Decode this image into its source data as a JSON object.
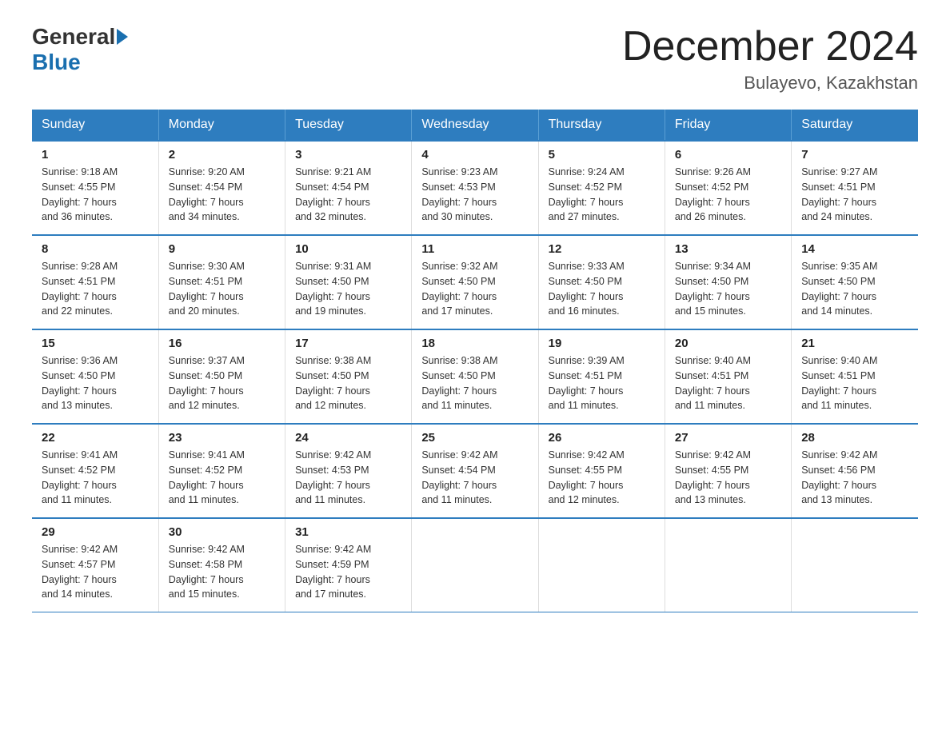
{
  "logo": {
    "general": "General",
    "blue": "Blue"
  },
  "title": "December 2024",
  "subtitle": "Bulayevo, Kazakhstan",
  "headers": [
    "Sunday",
    "Monday",
    "Tuesday",
    "Wednesday",
    "Thursday",
    "Friday",
    "Saturday"
  ],
  "weeks": [
    [
      {
        "day": "1",
        "info": "Sunrise: 9:18 AM\nSunset: 4:55 PM\nDaylight: 7 hours\nand 36 minutes."
      },
      {
        "day": "2",
        "info": "Sunrise: 9:20 AM\nSunset: 4:54 PM\nDaylight: 7 hours\nand 34 minutes."
      },
      {
        "day": "3",
        "info": "Sunrise: 9:21 AM\nSunset: 4:54 PM\nDaylight: 7 hours\nand 32 minutes."
      },
      {
        "day": "4",
        "info": "Sunrise: 9:23 AM\nSunset: 4:53 PM\nDaylight: 7 hours\nand 30 minutes."
      },
      {
        "day": "5",
        "info": "Sunrise: 9:24 AM\nSunset: 4:52 PM\nDaylight: 7 hours\nand 27 minutes."
      },
      {
        "day": "6",
        "info": "Sunrise: 9:26 AM\nSunset: 4:52 PM\nDaylight: 7 hours\nand 26 minutes."
      },
      {
        "day": "7",
        "info": "Sunrise: 9:27 AM\nSunset: 4:51 PM\nDaylight: 7 hours\nand 24 minutes."
      }
    ],
    [
      {
        "day": "8",
        "info": "Sunrise: 9:28 AM\nSunset: 4:51 PM\nDaylight: 7 hours\nand 22 minutes."
      },
      {
        "day": "9",
        "info": "Sunrise: 9:30 AM\nSunset: 4:51 PM\nDaylight: 7 hours\nand 20 minutes."
      },
      {
        "day": "10",
        "info": "Sunrise: 9:31 AM\nSunset: 4:50 PM\nDaylight: 7 hours\nand 19 minutes."
      },
      {
        "day": "11",
        "info": "Sunrise: 9:32 AM\nSunset: 4:50 PM\nDaylight: 7 hours\nand 17 minutes."
      },
      {
        "day": "12",
        "info": "Sunrise: 9:33 AM\nSunset: 4:50 PM\nDaylight: 7 hours\nand 16 minutes."
      },
      {
        "day": "13",
        "info": "Sunrise: 9:34 AM\nSunset: 4:50 PM\nDaylight: 7 hours\nand 15 minutes."
      },
      {
        "day": "14",
        "info": "Sunrise: 9:35 AM\nSunset: 4:50 PM\nDaylight: 7 hours\nand 14 minutes."
      }
    ],
    [
      {
        "day": "15",
        "info": "Sunrise: 9:36 AM\nSunset: 4:50 PM\nDaylight: 7 hours\nand 13 minutes."
      },
      {
        "day": "16",
        "info": "Sunrise: 9:37 AM\nSunset: 4:50 PM\nDaylight: 7 hours\nand 12 minutes."
      },
      {
        "day": "17",
        "info": "Sunrise: 9:38 AM\nSunset: 4:50 PM\nDaylight: 7 hours\nand 12 minutes."
      },
      {
        "day": "18",
        "info": "Sunrise: 9:38 AM\nSunset: 4:50 PM\nDaylight: 7 hours\nand 11 minutes."
      },
      {
        "day": "19",
        "info": "Sunrise: 9:39 AM\nSunset: 4:51 PM\nDaylight: 7 hours\nand 11 minutes."
      },
      {
        "day": "20",
        "info": "Sunrise: 9:40 AM\nSunset: 4:51 PM\nDaylight: 7 hours\nand 11 minutes."
      },
      {
        "day": "21",
        "info": "Sunrise: 9:40 AM\nSunset: 4:51 PM\nDaylight: 7 hours\nand 11 minutes."
      }
    ],
    [
      {
        "day": "22",
        "info": "Sunrise: 9:41 AM\nSunset: 4:52 PM\nDaylight: 7 hours\nand 11 minutes."
      },
      {
        "day": "23",
        "info": "Sunrise: 9:41 AM\nSunset: 4:52 PM\nDaylight: 7 hours\nand 11 minutes."
      },
      {
        "day": "24",
        "info": "Sunrise: 9:42 AM\nSunset: 4:53 PM\nDaylight: 7 hours\nand 11 minutes."
      },
      {
        "day": "25",
        "info": "Sunrise: 9:42 AM\nSunset: 4:54 PM\nDaylight: 7 hours\nand 11 minutes."
      },
      {
        "day": "26",
        "info": "Sunrise: 9:42 AM\nSunset: 4:55 PM\nDaylight: 7 hours\nand 12 minutes."
      },
      {
        "day": "27",
        "info": "Sunrise: 9:42 AM\nSunset: 4:55 PM\nDaylight: 7 hours\nand 13 minutes."
      },
      {
        "day": "28",
        "info": "Sunrise: 9:42 AM\nSunset: 4:56 PM\nDaylight: 7 hours\nand 13 minutes."
      }
    ],
    [
      {
        "day": "29",
        "info": "Sunrise: 9:42 AM\nSunset: 4:57 PM\nDaylight: 7 hours\nand 14 minutes."
      },
      {
        "day": "30",
        "info": "Sunrise: 9:42 AM\nSunset: 4:58 PM\nDaylight: 7 hours\nand 15 minutes."
      },
      {
        "day": "31",
        "info": "Sunrise: 9:42 AM\nSunset: 4:59 PM\nDaylight: 7 hours\nand 17 minutes."
      },
      {
        "day": "",
        "info": ""
      },
      {
        "day": "",
        "info": ""
      },
      {
        "day": "",
        "info": ""
      },
      {
        "day": "",
        "info": ""
      }
    ]
  ]
}
